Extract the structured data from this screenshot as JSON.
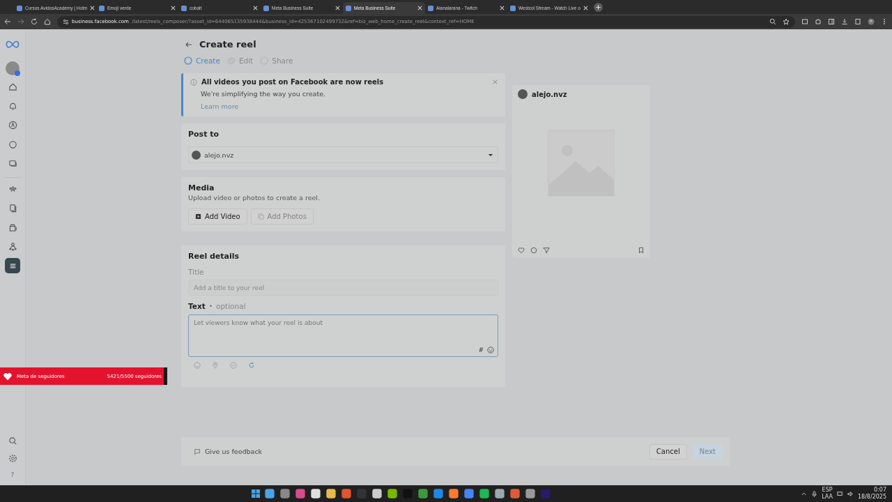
{
  "browser": {
    "tabs": [
      {
        "title": "Cursos AvidosAcademy | Hotm",
        "selected": false
      },
      {
        "title": "Emoji verde",
        "selected": false
      },
      {
        "title": "cobalt",
        "selected": false
      },
      {
        "title": "Meta Business Suite",
        "selected": false
      },
      {
        "title": "Meta Business Suite",
        "selected": true
      },
      {
        "title": "Alanalarana - Twitch",
        "selected": false
      },
      {
        "title": "Westcol Stream - Watch Live o",
        "selected": false
      }
    ],
    "url_host": "business.facebook.com",
    "url_path": "/latest/reels_composer/?asset_id=644065135938444&business_id=425367102499732&ref=biz_web_home_create_reel&context_ref=HOME"
  },
  "sidebar": {
    "items": [
      {
        "kind": "home",
        "selected": false
      },
      {
        "kind": "bell",
        "selected": false
      },
      {
        "kind": "compass",
        "selected": false
      },
      {
        "kind": "chat",
        "selected": false
      },
      {
        "kind": "media",
        "selected": false
      },
      {
        "kind": "people",
        "selected": false
      },
      {
        "kind": "pages",
        "selected": false
      },
      {
        "kind": "ads",
        "selected": false
      },
      {
        "kind": "network",
        "selected": false
      },
      {
        "kind": "menu",
        "selected": true
      }
    ],
    "help": "?"
  },
  "page": {
    "title": "Create reel",
    "steps": [
      {
        "label": "Create",
        "selected": true,
        "kind": "ring"
      },
      {
        "label": "Edit",
        "selected": false,
        "kind": "check"
      },
      {
        "label": "Share",
        "selected": false,
        "kind": "ring"
      }
    ],
    "notice": {
      "title": "All videos you post on Facebook are now reels",
      "body": "We're simplifying the way you create.",
      "link": "Learn more"
    },
    "post_to": {
      "heading": "Post to",
      "account": "alejo.nvz"
    },
    "media": {
      "heading": "Media",
      "subtitle": "Upload video or photos to create a reel.",
      "buttons": [
        {
          "label": "Add Video",
          "kind": "video",
          "disabled": false
        },
        {
          "label": "Add Photos",
          "kind": "photos",
          "disabled": true
        }
      ]
    },
    "details": {
      "heading": "Reel details",
      "title_label": "Title",
      "title_placeholder": "Add a title to your reel",
      "text_label": "Text",
      "text_separator": "•",
      "text_optional": "optional",
      "text_placeholder": "Let viewers know what your reel is about",
      "hashtag": "#"
    },
    "preview": {
      "account": "alejo.nvz"
    },
    "footer": {
      "feedback": "Give us feedback",
      "buttons": [
        {
          "label": "Cancel",
          "disabled": false
        },
        {
          "label": "Next",
          "disabled": true
        }
      ]
    }
  },
  "overlay": {
    "label": "Meta de seguidores",
    "count": "5421/5500 seguidores",
    "level": 0.98
  },
  "taskbar": {
    "lang": "ESP",
    "layout": "LAA",
    "time": "0:07",
    "date": "18/8/2025"
  }
}
